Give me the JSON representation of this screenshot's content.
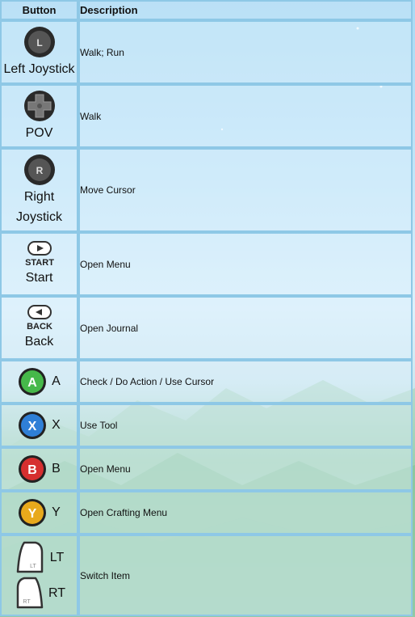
{
  "table": {
    "header": {
      "button": "Button",
      "description": "Description"
    },
    "rows": [
      {
        "button_label": "Left Joystick",
        "icon": "left-joystick-icon",
        "icon_letter": "L",
        "description": "Walk; Run"
      },
      {
        "button_label": "POV",
        "icon": "dpad-icon",
        "description": "Walk"
      },
      {
        "button_label_line1": "Right",
        "button_label_line2": "Joystick",
        "icon": "right-joystick-icon",
        "icon_letter": "R",
        "description": "Move Cursor"
      },
      {
        "button_label": "Start",
        "icon": "start-button-icon",
        "icon_text": "START",
        "description": "Open Menu"
      },
      {
        "button_label": "Back",
        "icon": "back-button-icon",
        "icon_text": "BACK",
        "description": "Open Journal"
      },
      {
        "button_label": "A",
        "icon": "a-button-icon",
        "icon_letter": "A",
        "color": "#46b84a",
        "description": "Check / Do Action / Use Cursor"
      },
      {
        "button_label": "X",
        "icon": "x-button-icon",
        "icon_letter": "X",
        "color": "#2f7fd6",
        "description": "Use Tool"
      },
      {
        "button_label": "B",
        "icon": "b-button-icon",
        "icon_letter": "B",
        "color": "#d62f2f",
        "description": "Open Menu"
      },
      {
        "button_label": "Y",
        "icon": "y-button-icon",
        "icon_letter": "Y",
        "color": "#e8a91c",
        "description": "Open Crafting Menu"
      },
      {
        "button_label_1": "LT",
        "button_label_2": "RT",
        "icon_1": "lt-trigger-icon",
        "icon_2": "rt-trigger-icon",
        "description": "Switch Item"
      }
    ]
  }
}
